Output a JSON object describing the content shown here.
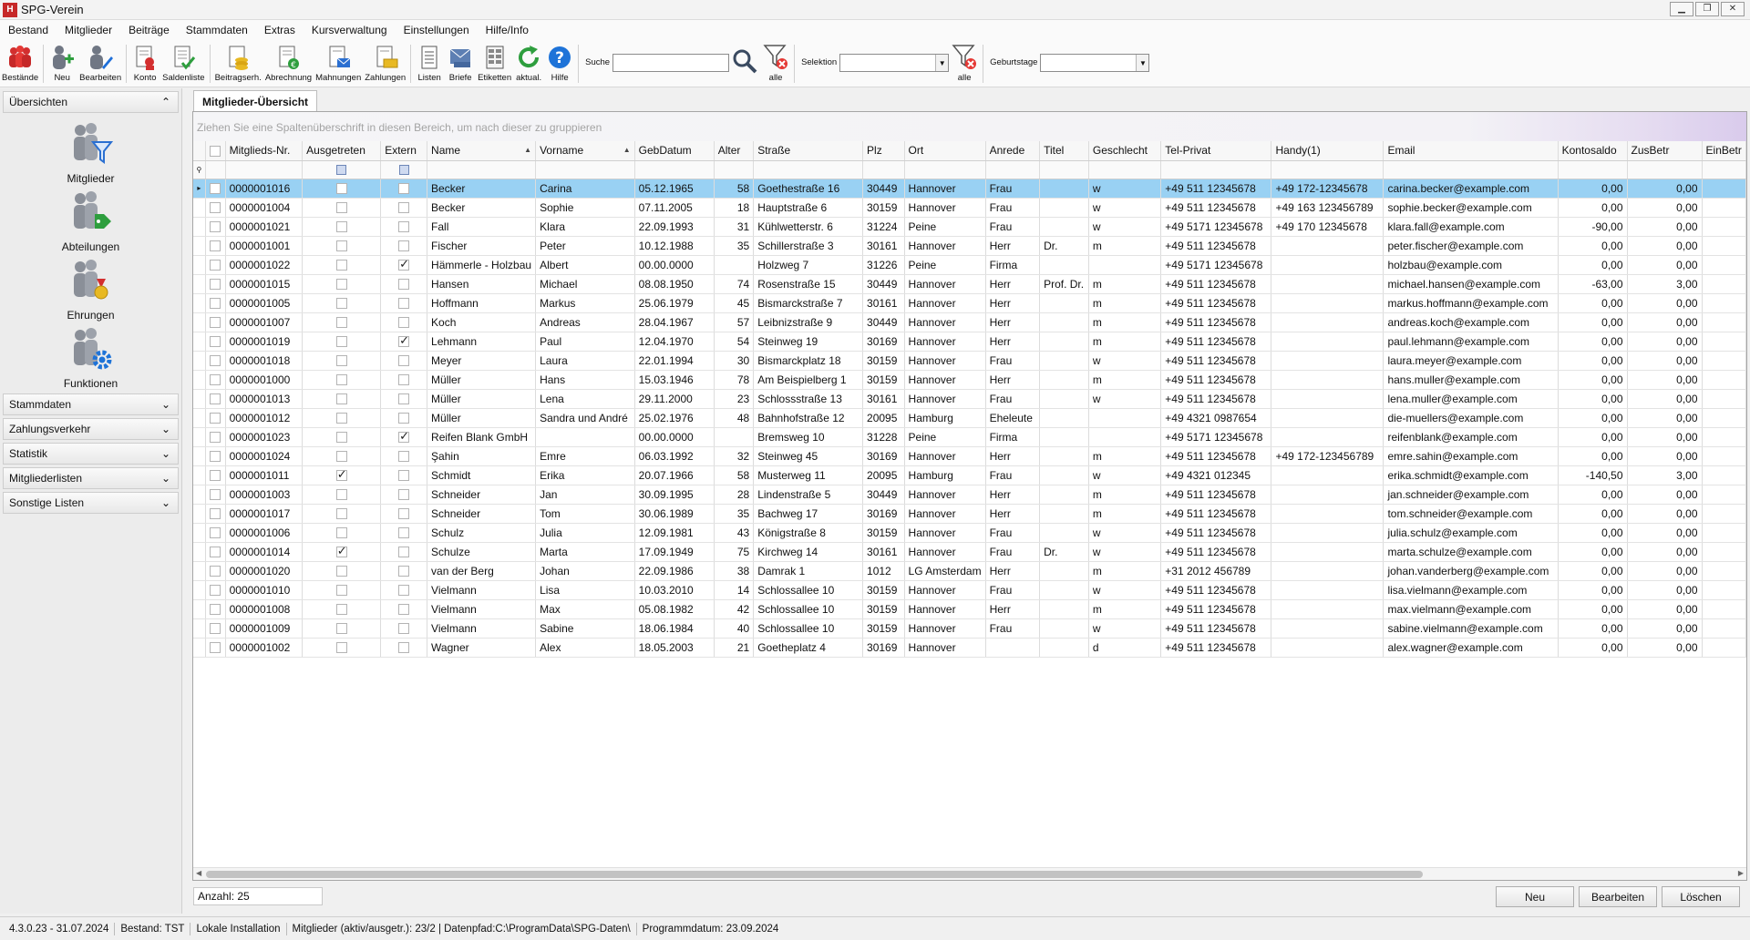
{
  "window": {
    "title": "SPG-Verein",
    "logo": "H"
  },
  "menu": [
    "Bestand",
    "Mitglieder",
    "Beiträge",
    "Stammdaten",
    "Extras",
    "Kursverwaltung",
    "Einstellungen",
    "Hilfe/Info"
  ],
  "toolbar": {
    "buttons": [
      {
        "label": "Bestände",
        "icon": "people-icon"
      },
      {
        "label": "Neu",
        "icon": "add-user-icon"
      },
      {
        "label": "Bearbeiten",
        "icon": "edit-user-icon"
      },
      {
        "label": "Konto",
        "icon": "account-icon"
      },
      {
        "label": "Saldenliste",
        "icon": "balance-list-icon"
      },
      {
        "label": "Beitragserh.",
        "icon": "contribution-icon"
      },
      {
        "label": "Abrechnung",
        "icon": "billing-icon"
      },
      {
        "label": "Mahnungen",
        "icon": "reminder-icon"
      },
      {
        "label": "Zahlungen",
        "icon": "payments-icon"
      },
      {
        "label": "Listen",
        "icon": "lists-icon"
      },
      {
        "label": "Briefe",
        "icon": "letters-icon"
      },
      {
        "label": "Etiketten",
        "icon": "labels-icon"
      },
      {
        "label": "aktual.",
        "icon": "refresh-icon"
      },
      {
        "label": "Hilfe",
        "icon": "help-icon"
      }
    ],
    "search_label": "Suche",
    "search_value": "",
    "filter_all_label": "alle",
    "selection_label": "Selektion",
    "selection_value": "",
    "selection_all_label": "alle",
    "birthdays_label": "Geburtstage",
    "birthdays_value": ""
  },
  "sidebar": {
    "overview_header": "Übersichten",
    "overview_items": [
      {
        "label": "Mitglieder",
        "icon": "members-filter-icon"
      },
      {
        "label": "Abteilungen",
        "icon": "departments-tag-icon"
      },
      {
        "label": "Ehrungen",
        "icon": "honors-medal-icon"
      },
      {
        "label": "Funktionen",
        "icon": "functions-gear-icon"
      }
    ],
    "sections": [
      "Stammdaten",
      "Zahlungsverkehr",
      "Statistik",
      "Mitgliederlisten",
      "Sonstige Listen"
    ]
  },
  "main": {
    "tab": "Mitglieder-Übersicht",
    "group_hint": "Ziehen Sie eine Spaltenüberschrift in diesen Bereich, um nach dieser zu gruppieren",
    "columns": [
      "Mitglieds-Nr.",
      "Ausgetreten",
      "Extern",
      "Name",
      "Vorname",
      "GebDatum",
      "Alter",
      "Straße",
      "Plz",
      "Ort",
      "Anrede",
      "Titel",
      "Geschlecht",
      "Tel-Privat",
      "Handy(1)",
      "Email",
      "Kontosaldo",
      "ZusBetr",
      "EinBetr"
    ],
    "rows": [
      {
        "nr": "0000001016",
        "aus": false,
        "ext": false,
        "name": "Becker",
        "vorname": "Carina",
        "geb": "05.12.1965",
        "alter": "58",
        "strasse": "Goethestraße 16",
        "plz": "30449",
        "ort": "Hannover",
        "anrede": "Frau",
        "titel": "",
        "geschlecht": "w",
        "tel": "+49 511 12345678",
        "handy": "+49 172-12345678",
        "email": "carina.becker@example.com",
        "saldo": "0,00",
        "zus": "0,00"
      },
      {
        "nr": "0000001004",
        "aus": false,
        "ext": false,
        "name": "Becker",
        "vorname": "Sophie",
        "geb": "07.11.2005",
        "alter": "18",
        "strasse": "Hauptstraße 6",
        "plz": "30159",
        "ort": "Hannover",
        "anrede": "Frau",
        "titel": "",
        "geschlecht": "w",
        "tel": "+49 511 12345678",
        "handy": "+49 163 123456789",
        "email": "sophie.becker@example.com",
        "saldo": "0,00",
        "zus": "0,00"
      },
      {
        "nr": "0000001021",
        "aus": false,
        "ext": false,
        "name": "Fall",
        "vorname": "Klara",
        "geb": "22.09.1993",
        "alter": "31",
        "strasse": "Kühlwetterstr. 6",
        "plz": "31224",
        "ort": "Peine",
        "anrede": "Frau",
        "titel": "",
        "geschlecht": "w",
        "tel": "+49 5171 12345678",
        "handy": "+49 170 12345678",
        "email": "klara.fall@example.com",
        "saldo": "-90,00",
        "zus": "0,00"
      },
      {
        "nr": "0000001001",
        "aus": false,
        "ext": false,
        "name": "Fischer",
        "vorname": "Peter",
        "geb": "10.12.1988",
        "alter": "35",
        "strasse": "Schillerstraße 3",
        "plz": "30161",
        "ort": "Hannover",
        "anrede": "Herr",
        "titel": "Dr.",
        "geschlecht": "m",
        "tel": "+49 511 12345678",
        "handy": "",
        "email": "peter.fischer@example.com",
        "saldo": "0,00",
        "zus": "0,00"
      },
      {
        "nr": "0000001022",
        "aus": false,
        "ext": true,
        "name": "Hämmerle - Holzbau",
        "vorname": "Albert",
        "geb": "00.00.0000",
        "alter": "",
        "strasse": "Holzweg 7",
        "plz": "31226",
        "ort": "Peine",
        "anrede": "Firma",
        "titel": "",
        "geschlecht": "",
        "tel": "+49 5171 12345678",
        "handy": "",
        "email": "holzbau@example.com",
        "saldo": "0,00",
        "zus": "0,00"
      },
      {
        "nr": "0000001015",
        "aus": false,
        "ext": false,
        "name": "Hansen",
        "vorname": "Michael",
        "geb": "08.08.1950",
        "alter": "74",
        "strasse": "Rosenstraße 15",
        "plz": "30449",
        "ort": "Hannover",
        "anrede": "Herr",
        "titel": "Prof. Dr.",
        "geschlecht": "m",
        "tel": "+49 511 12345678",
        "handy": "",
        "email": "michael.hansen@example.com",
        "saldo": "-63,00",
        "zus": "3,00"
      },
      {
        "nr": "0000001005",
        "aus": false,
        "ext": false,
        "name": "Hoffmann",
        "vorname": "Markus",
        "geb": "25.06.1979",
        "alter": "45",
        "strasse": "Bismarckstraße 7",
        "plz": "30161",
        "ort": "Hannover",
        "anrede": "Herr",
        "titel": "",
        "geschlecht": "m",
        "tel": "+49 511 12345678",
        "handy": "",
        "email": "markus.hoffmann@example.com",
        "saldo": "0,00",
        "zus": "0,00"
      },
      {
        "nr": "0000001007",
        "aus": false,
        "ext": false,
        "name": "Koch",
        "vorname": "Andreas",
        "geb": "28.04.1967",
        "alter": "57",
        "strasse": "Leibnizstraße 9",
        "plz": "30449",
        "ort": "Hannover",
        "anrede": "Herr",
        "titel": "",
        "geschlecht": "m",
        "tel": "+49 511 12345678",
        "handy": "",
        "email": "andreas.koch@example.com",
        "saldo": "0,00",
        "zus": "0,00"
      },
      {
        "nr": "0000001019",
        "aus": false,
        "ext": true,
        "name": "Lehmann",
        "vorname": "Paul",
        "geb": "12.04.1970",
        "alter": "54",
        "strasse": "Steinweg 19",
        "plz": "30169",
        "ort": "Hannover",
        "anrede": "Herr",
        "titel": "",
        "geschlecht": "m",
        "tel": "+49 511 12345678",
        "handy": "",
        "email": "paul.lehmann@example.com",
        "saldo": "0,00",
        "zus": "0,00"
      },
      {
        "nr": "0000001018",
        "aus": false,
        "ext": false,
        "name": "Meyer",
        "vorname": "Laura",
        "geb": "22.01.1994",
        "alter": "30",
        "strasse": "Bismarckplatz 18",
        "plz": "30159",
        "ort": "Hannover",
        "anrede": "Frau",
        "titel": "",
        "geschlecht": "w",
        "tel": "+49 511 12345678",
        "handy": "",
        "email": "laura.meyer@example.com",
        "saldo": "0,00",
        "zus": "0,00"
      },
      {
        "nr": "0000001000",
        "aus": false,
        "ext": false,
        "name": "Müller",
        "vorname": "Hans",
        "geb": "15.03.1946",
        "alter": "78",
        "strasse": "Am Beispielberg 1",
        "plz": "30159",
        "ort": "Hannover",
        "anrede": "Herr",
        "titel": "",
        "geschlecht": "m",
        "tel": "+49 511 12345678",
        "handy": "",
        "email": "hans.muller@example.com",
        "saldo": "0,00",
        "zus": "0,00"
      },
      {
        "nr": "0000001013",
        "aus": false,
        "ext": false,
        "name": "Müller",
        "vorname": "Lena",
        "geb": "29.11.2000",
        "alter": "23",
        "strasse": "Schlossstraße 13",
        "plz": "30161",
        "ort": "Hannover",
        "anrede": "Frau",
        "titel": "",
        "geschlecht": "w",
        "tel": "+49 511 12345678",
        "handy": "",
        "email": "lena.muller@example.com",
        "saldo": "0,00",
        "zus": "0,00"
      },
      {
        "nr": "0000001012",
        "aus": false,
        "ext": false,
        "name": "Müller",
        "vorname": "Sandra und André",
        "geb": "25.02.1976",
        "alter": "48",
        "strasse": "Bahnhofstraße 12",
        "plz": "20095",
        "ort": "Hamburg",
        "anrede": "Eheleute",
        "titel": "",
        "geschlecht": "",
        "tel": "+49 4321 0987654",
        "handy": "",
        "email": "die-muellers@example.com",
        "saldo": "0,00",
        "zus": "0,00"
      },
      {
        "nr": "0000001023",
        "aus": false,
        "ext": true,
        "name": "Reifen Blank GmbH",
        "vorname": "",
        "geb": "00.00.0000",
        "alter": "",
        "strasse": "Bremsweg 10",
        "plz": "31228",
        "ort": "Peine",
        "anrede": "Firma",
        "titel": "",
        "geschlecht": "",
        "tel": "+49 5171 12345678",
        "handy": "",
        "email": "reifenblank@example.com",
        "saldo": "0,00",
        "zus": "0,00"
      },
      {
        "nr": "0000001024",
        "aus": false,
        "ext": false,
        "name": "Şahin",
        "vorname": "Emre",
        "geb": "06.03.1992",
        "alter": "32",
        "strasse": "Steinweg 45",
        "plz": "30169",
        "ort": "Hannover",
        "anrede": "Herr",
        "titel": "",
        "geschlecht": "m",
        "tel": "+49 511 12345678",
        "handy": "+49 172-123456789",
        "email": "emre.sahin@example.com",
        "saldo": "0,00",
        "zus": "0,00"
      },
      {
        "nr": "0000001011",
        "aus": true,
        "ext": false,
        "name": "Schmidt",
        "vorname": "Erika",
        "geb": "20.07.1966",
        "alter": "58",
        "strasse": "Musterweg 11",
        "plz": "20095",
        "ort": "Hamburg",
        "anrede": "Frau",
        "titel": "",
        "geschlecht": "w",
        "tel": "+49 4321 012345",
        "handy": "",
        "email": "erika.schmidt@example.com",
        "saldo": "-140,50",
        "zus": "3,00"
      },
      {
        "nr": "0000001003",
        "aus": false,
        "ext": false,
        "name": "Schneider",
        "vorname": "Jan",
        "geb": "30.09.1995",
        "alter": "28",
        "strasse": "Lindenstraße 5",
        "plz": "30449",
        "ort": "Hannover",
        "anrede": "Herr",
        "titel": "",
        "geschlecht": "m",
        "tel": "+49 511 12345678",
        "handy": "",
        "email": "jan.schneider@example.com",
        "saldo": "0,00",
        "zus": "0,00"
      },
      {
        "nr": "0000001017",
        "aus": false,
        "ext": false,
        "name": "Schneider",
        "vorname": "Tom",
        "geb": "30.06.1989",
        "alter": "35",
        "strasse": "Bachweg 17",
        "plz": "30169",
        "ort": "Hannover",
        "anrede": "Herr",
        "titel": "",
        "geschlecht": "m",
        "tel": "+49 511 12345678",
        "handy": "",
        "email": "tom.schneider@example.com",
        "saldo": "0,00",
        "zus": "0,00"
      },
      {
        "nr": "0000001006",
        "aus": false,
        "ext": false,
        "name": "Schulz",
        "vorname": "Julia",
        "geb": "12.09.1981",
        "alter": "43",
        "strasse": "Königstraße 8",
        "plz": "30159",
        "ort": "Hannover",
        "anrede": "Frau",
        "titel": "",
        "geschlecht": "w",
        "tel": "+49 511 12345678",
        "handy": "",
        "email": "julia.schulz@example.com",
        "saldo": "0,00",
        "zus": "0,00"
      },
      {
        "nr": "0000001014",
        "aus": true,
        "ext": false,
        "name": "Schulze",
        "vorname": "Marta",
        "geb": "17.09.1949",
        "alter": "75",
        "strasse": "Kirchweg 14",
        "plz": "30161",
        "ort": "Hannover",
        "anrede": "Frau",
        "titel": "Dr.",
        "geschlecht": "w",
        "tel": "+49 511 12345678",
        "handy": "",
        "email": "marta.schulze@example.com",
        "saldo": "0,00",
        "zus": "0,00"
      },
      {
        "nr": "0000001020",
        "aus": false,
        "ext": false,
        "name": "van der Berg",
        "vorname": "Johan",
        "geb": "22.09.1986",
        "alter": "38",
        "strasse": "Damrak 1",
        "plz": "1012",
        "ort": "LG Amsterdam",
        "anrede": "Herr",
        "titel": "",
        "geschlecht": "m",
        "tel": "+31 2012 456789",
        "handy": "",
        "email": "johan.vanderberg@example.com",
        "saldo": "0,00",
        "zus": "0,00"
      },
      {
        "nr": "0000001010",
        "aus": false,
        "ext": false,
        "name": "Vielmann",
        "vorname": "Lisa",
        "geb": "10.03.2010",
        "alter": "14",
        "strasse": "Schlossallee 10",
        "plz": "30159",
        "ort": "Hannover",
        "anrede": "Frau",
        "titel": "",
        "geschlecht": "w",
        "tel": "+49 511 12345678",
        "handy": "",
        "email": "lisa.vielmann@example.com",
        "saldo": "0,00",
        "zus": "0,00"
      },
      {
        "nr": "0000001008",
        "aus": false,
        "ext": false,
        "name": "Vielmann",
        "vorname": "Max",
        "geb": "05.08.1982",
        "alter": "42",
        "strasse": "Schlossallee 10",
        "plz": "30159",
        "ort": "Hannover",
        "anrede": "Herr",
        "titel": "",
        "geschlecht": "m",
        "tel": "+49 511 12345678",
        "handy": "",
        "email": "max.vielmann@example.com",
        "saldo": "0,00",
        "zus": "0,00"
      },
      {
        "nr": "0000001009",
        "aus": false,
        "ext": false,
        "name": "Vielmann",
        "vorname": "Sabine",
        "geb": "18.06.1984",
        "alter": "40",
        "strasse": "Schlossallee 10",
        "plz": "30159",
        "ort": "Hannover",
        "anrede": "Frau",
        "titel": "",
        "geschlecht": "w",
        "tel": "+49 511 12345678",
        "handy": "",
        "email": "sabine.vielmann@example.com",
        "saldo": "0,00",
        "zus": "0,00"
      },
      {
        "nr": "0000001002",
        "aus": false,
        "ext": false,
        "name": "Wagner",
        "vorname": "Alex",
        "geb": "18.05.2003",
        "alter": "21",
        "strasse": "Goetheplatz 4",
        "plz": "30169",
        "ort": "Hannover",
        "anrede": "",
        "titel": "",
        "geschlecht": "d",
        "tel": "+49 511 12345678",
        "handy": "",
        "email": "alex.wagner@example.com",
        "saldo": "0,00",
        "zus": "0,00"
      }
    ],
    "count_label": "Anzahl: 25",
    "buttons": {
      "new": "Neu",
      "edit": "Bearbeiten",
      "delete": "Löschen"
    }
  },
  "statusbar": [
    "4.3.0.23 - 31.07.2024",
    "Bestand: TST",
    "Lokale Installation",
    "Mitglieder (aktiv/ausgetr.): 23/2 | Datenpfad:C:\\ProgramData\\SPG-Daten\\",
    "Programmdatum: 23.09.2024"
  ]
}
